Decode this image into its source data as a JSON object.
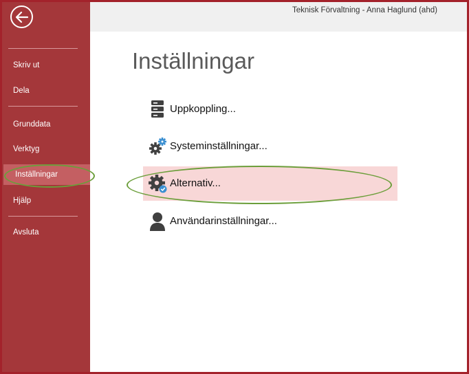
{
  "window": {
    "title": "Teknisk Förvaltning - Anna Haglund (ahd)"
  },
  "sidebar": {
    "back_icon": "back-arrow-icon",
    "items": [
      {
        "label": "Skriv ut"
      },
      {
        "label": "Dela"
      },
      {
        "label": "Grunddata"
      },
      {
        "label": "Verktyg"
      },
      {
        "label": "Inställningar",
        "selected": true
      },
      {
        "label": "Hjälp"
      },
      {
        "label": "Avsluta"
      }
    ]
  },
  "main": {
    "title": "Inställningar",
    "commands": [
      {
        "label": "Uppkoppling...",
        "icon": "server-icon"
      },
      {
        "label": "Systeminställningar...",
        "icon": "gears-icon"
      },
      {
        "label": "Alternativ...",
        "icon": "gear-check-icon",
        "highlighted": true
      },
      {
        "label": "Användarinställningar...",
        "icon": "user-icon"
      }
    ]
  },
  "colors": {
    "sidebar": "#a4373a",
    "sidebar_selected": "#c45f62",
    "highlight": "#f8d7d7",
    "annotation_ring": "#6b9e3a",
    "frame": "#a3222b",
    "title_text": "#5a5a5a"
  }
}
